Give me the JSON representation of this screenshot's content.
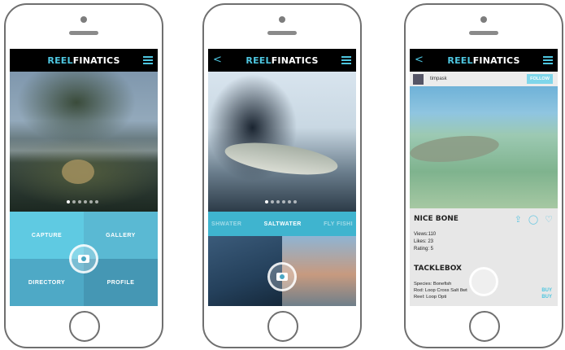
{
  "app": {
    "logo_reel": "REEL",
    "logo_fin": "FINATICS"
  },
  "screen1": {
    "menu": [
      "CAPTURE",
      "GALLERY",
      "DIRECTORY",
      "PROFILE"
    ]
  },
  "screen2": {
    "categories": [
      "SHWATER",
      "SALTWATER",
      "FLY FISHI"
    ]
  },
  "screen3": {
    "username": "timpask",
    "follow_label": "FOLLOW",
    "post_title": "NICE BONE",
    "views": "Views:110",
    "likes": "Likes:  23",
    "rating": "Rating:    5",
    "tacklebox_title": "TACKLEBOX",
    "gear": [
      {
        "text": "Species:  Bonefish",
        "buy": ""
      },
      {
        "text": "Rod:  Loop Cross Salt 8wt",
        "buy": "BUY"
      },
      {
        "text": "Reel: Loop Opti",
        "buy": "BUY"
      }
    ]
  },
  "colors": {
    "accent": "#4ec6e0",
    "tile_light": "#5fcae2",
    "tile_dark": "#4597b4"
  },
  "icons": [
    "menu-icon",
    "back-icon",
    "camera-icon",
    "share-icon",
    "comment-icon",
    "heart-icon"
  ]
}
